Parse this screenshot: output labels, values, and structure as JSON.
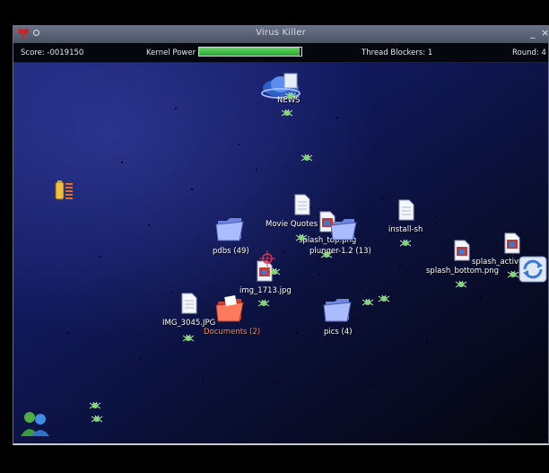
{
  "window": {
    "title": "Virus Killer",
    "minimize_glyph": "_",
    "close_glyph": "×"
  },
  "hud": {
    "score": "Score: -0019150",
    "kernel_power_label": "Kernel Power",
    "kernel_power_fraction": 0.98,
    "thread_blockers": "Thread Blockers: 1",
    "round": "Round: 4"
  },
  "icons": {
    "news": "NEWS",
    "pdbs": "pdbs (49)",
    "movie_quotes": "Movie Quotes",
    "splash_top": "splash_top.png",
    "plunger": "plunger-1.2 (13)",
    "install": "install-sh",
    "img_1713": "img_1713.jpg",
    "splash_bottom": "splash_bottom.png",
    "splash_active": "splash_active",
    "img_3045": "IMG_3045.JPG",
    "documents": "Documents (2)",
    "pics": "pics (4)"
  },
  "colors": {
    "selected_label": "#ff8a50",
    "power_fill": "#3cc23c",
    "folder_blue": "#8aa4ff",
    "folder_selected": "#ff6a4a",
    "virus_green": "#7fd86f"
  },
  "icon_names": [
    "folder-icon",
    "image-file-icon",
    "text-file-icon",
    "virus-bug-icon",
    "crosshair-icon",
    "battery-icon",
    "people-icon",
    "recycle-icon"
  ]
}
